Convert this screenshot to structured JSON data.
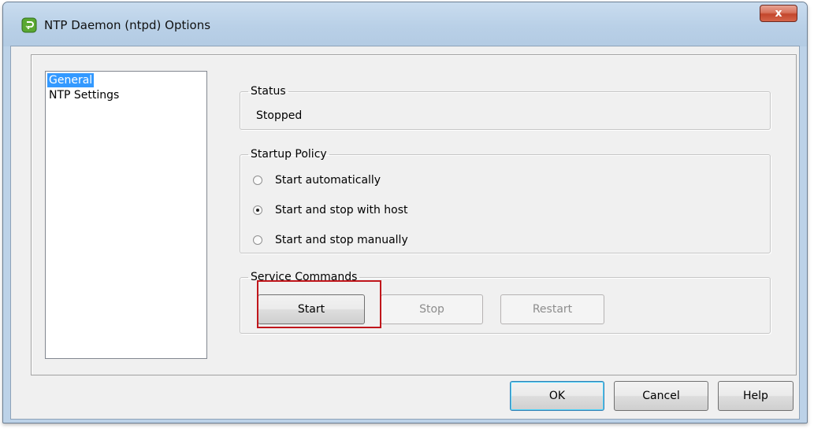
{
  "window": {
    "title": "NTP Daemon (ntpd) Options",
    "close_label": "x",
    "accent_color": "#3399ff",
    "highlight_color": "#c0161b"
  },
  "nav": {
    "items": [
      {
        "label": "General",
        "selected": true
      },
      {
        "label": "NTP Settings",
        "selected": false
      }
    ]
  },
  "status": {
    "legend": "Status",
    "value": "Stopped"
  },
  "startup_policy": {
    "legend": "Startup Policy",
    "options": [
      {
        "label": "Start automatically",
        "checked": false
      },
      {
        "label": "Start and stop with host",
        "checked": true
      },
      {
        "label": "Start and stop manually",
        "checked": false
      }
    ]
  },
  "service_commands": {
    "legend": "Service Commands",
    "start_label": "Start",
    "stop_label": "Stop",
    "restart_label": "Restart"
  },
  "footer": {
    "ok_label": "OK",
    "cancel_label": "Cancel",
    "help_label": "Help"
  }
}
